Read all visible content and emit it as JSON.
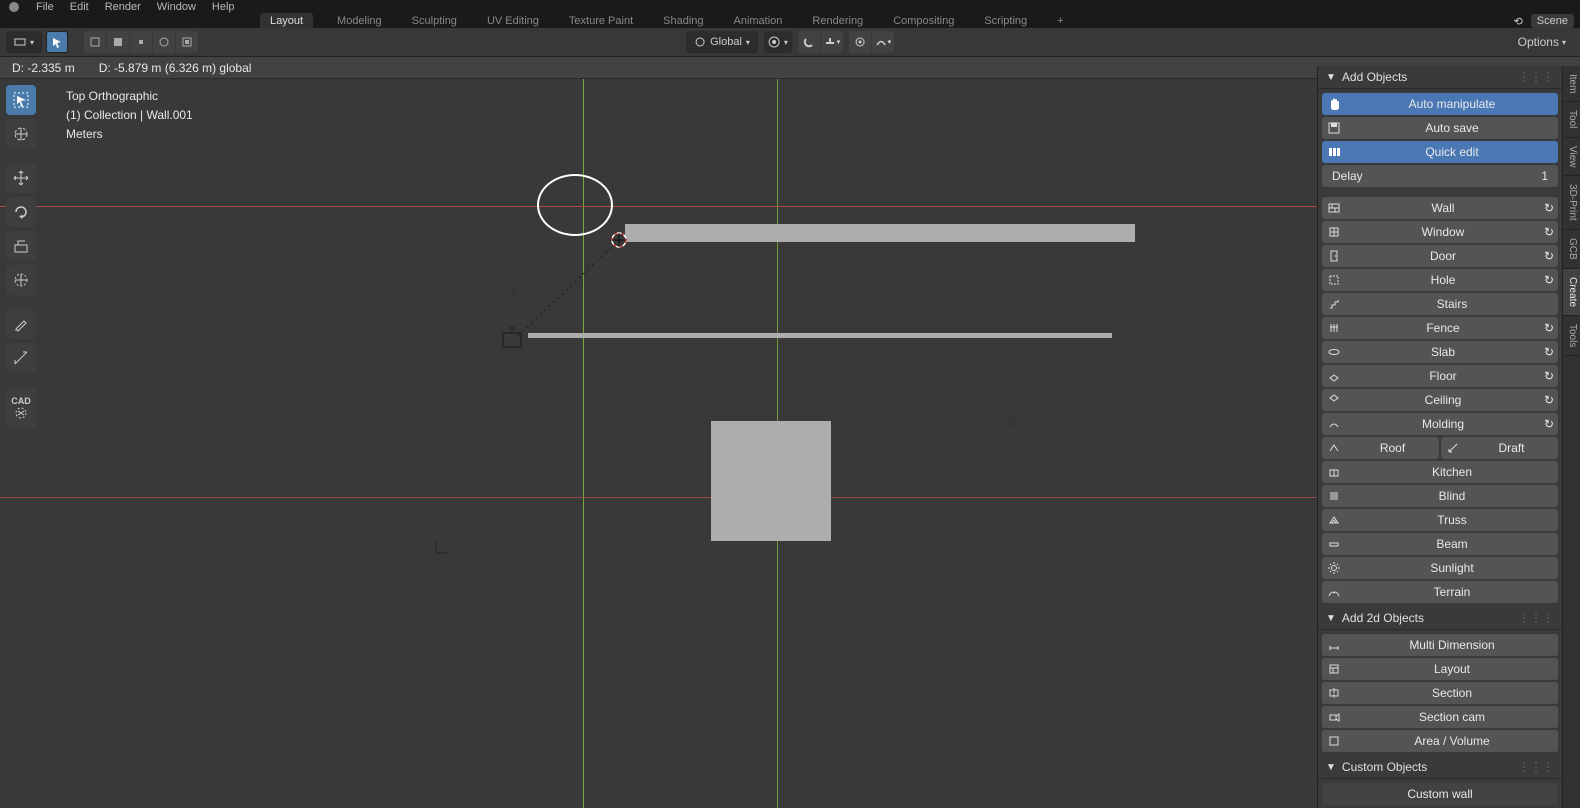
{
  "menu": {
    "items": [
      "File",
      "Edit",
      "Render",
      "Window",
      "Help"
    ]
  },
  "workspaces": {
    "tabs": [
      "Layout",
      "Modeling",
      "Sculpting",
      "UV Editing",
      "Texture Paint",
      "Shading",
      "Animation",
      "Rendering",
      "Compositing",
      "Scripting"
    ],
    "active": "Layout",
    "scene_label": "Scene"
  },
  "header": {
    "orientation": "Global",
    "options_label": "Options"
  },
  "status": {
    "d1": "D: -2.335 m",
    "d2": "D: -5.879 m (6.326 m) global"
  },
  "viewport": {
    "view_name": "Top Orthographic",
    "collection_line": "(1) Collection | Wall.001",
    "units": "Meters"
  },
  "npanel_tabs": [
    "Item",
    "Tool",
    "View",
    "3D-Print",
    "GCB",
    "Create",
    "Tools"
  ],
  "right": {
    "add_objects_header": "Add Objects",
    "auto_manipulate": "Auto manipulate",
    "auto_save": "Auto save",
    "quick_edit": "Quick edit",
    "delay_label": "Delay",
    "delay_value": "1",
    "wall": "Wall",
    "window": "Window",
    "door": "Door",
    "hole": "Hole",
    "stairs": "Stairs",
    "fence": "Fence",
    "slab": "Slab",
    "floor": "Floor",
    "ceiling": "Ceiling",
    "molding": "Molding",
    "roof": "Roof",
    "draft": "Draft",
    "kitchen": "Kitchen",
    "blind": "Blind",
    "truss": "Truss",
    "beam": "Beam",
    "sunlight": "Sunlight",
    "terrain": "Terrain",
    "add_2d_header": "Add 2d Objects",
    "multi_dimension": "Multi Dimension",
    "layout": "Layout",
    "section": "Section",
    "section_cam": "Section cam",
    "area_volume": "Area / Volume",
    "custom_header": "Custom Objects",
    "custom_wall": "Custom wall"
  }
}
